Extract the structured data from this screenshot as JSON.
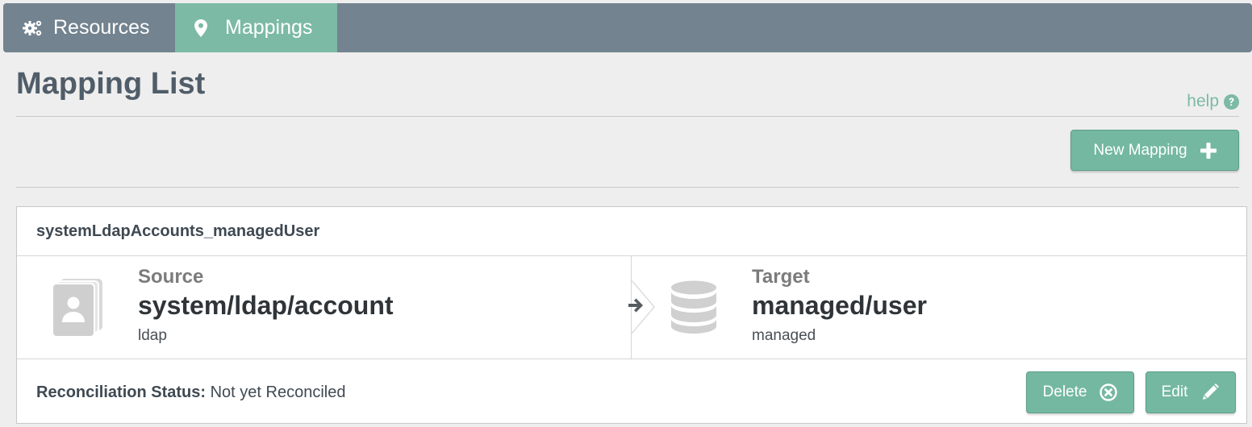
{
  "nav": {
    "resources_label": "Resources",
    "mappings_label": "Mappings",
    "active_tab": "Mappings"
  },
  "header": {
    "title": "Mapping List",
    "help_label": "help",
    "new_mapping_label": "New Mapping"
  },
  "mapping": {
    "name": "systemLdapAccounts_managedUser",
    "source": {
      "label": "Source",
      "name": "system/ldap/account",
      "sub": "ldap",
      "icon": "user-card-stack-icon"
    },
    "target": {
      "label": "Target",
      "name": "managed/user",
      "sub": "managed",
      "icon": "database-icon"
    },
    "recon_label": "Reconciliation Status:",
    "recon_value": "Not yet Reconciled",
    "delete_label": "Delete",
    "edit_label": "Edit"
  },
  "colors": {
    "nav_bg": "#73838f",
    "accent": "#7cbaa5",
    "button": "#74b8a1",
    "title": "#505d69"
  }
}
